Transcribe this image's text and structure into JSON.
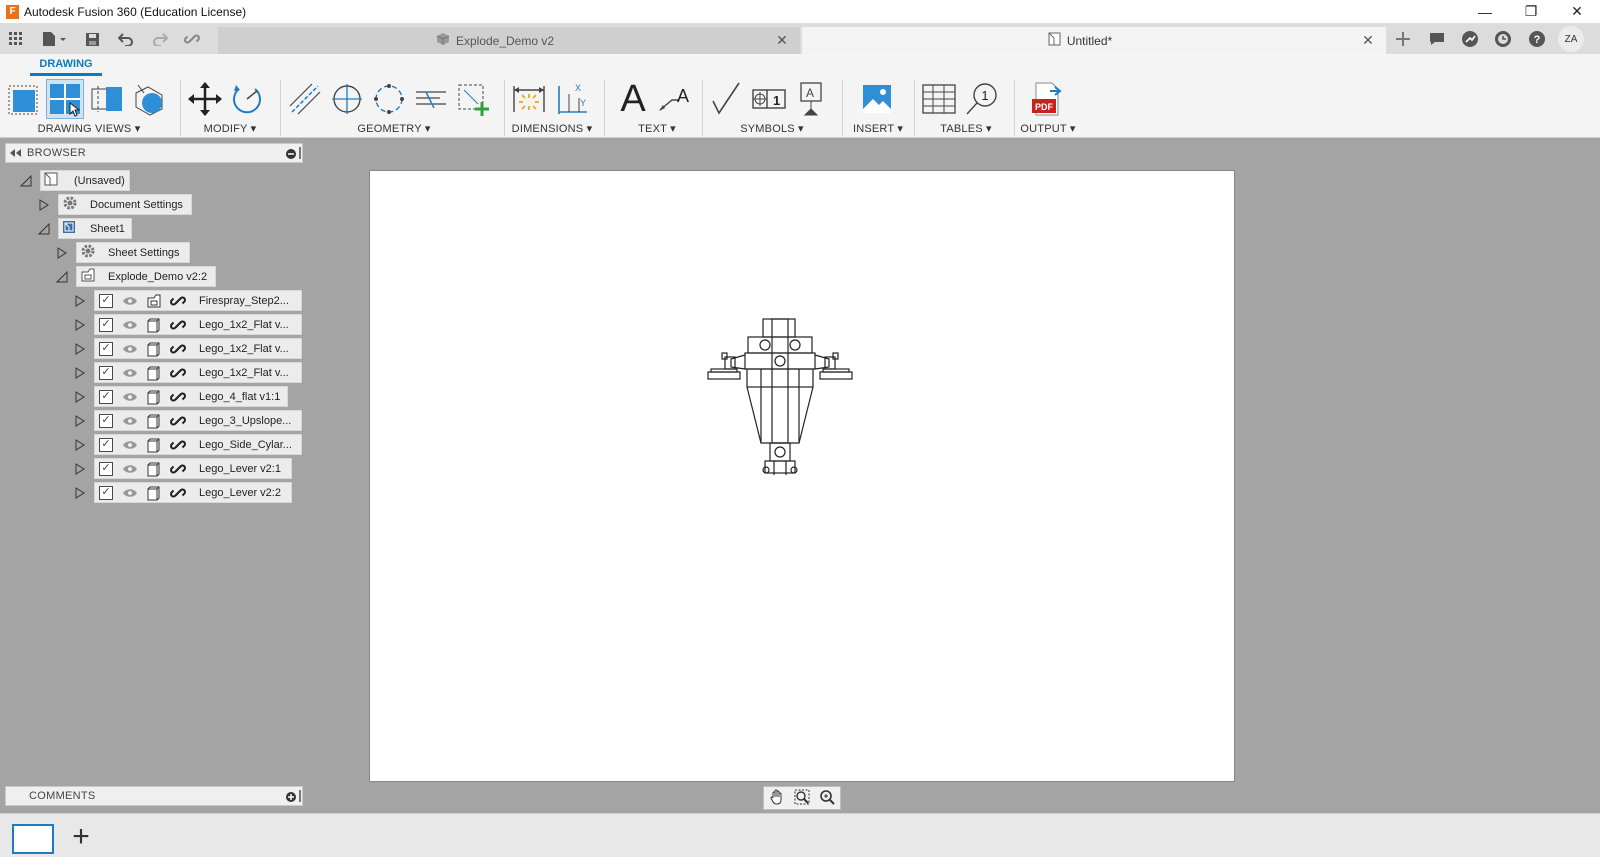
{
  "window": {
    "title": "Autodesk Fusion 360 (Education License)",
    "logo_letter": "F",
    "minimize_glyph": "—",
    "maximize_glyph": "❐",
    "close_glyph": "✕"
  },
  "tabs": [
    {
      "label": "Explode_Demo v2",
      "active": false
    },
    {
      "label": "Untitled*",
      "active": true
    }
  ],
  "tab_close_glyph": "✕",
  "user": {
    "initials": "ZA"
  },
  "workspace_tab": "DRAWING",
  "toolbar_groups": [
    {
      "label": "DRAWING VIEWS ▾"
    },
    {
      "label": "MODIFY ▾"
    },
    {
      "label": "GEOMETRY ▾"
    },
    {
      "label": "DIMENSIONS ▾"
    },
    {
      "label": "TEXT ▾"
    },
    {
      "label": "SYMBOLS ▾"
    },
    {
      "label": "INSERT ▾"
    },
    {
      "label": "TABLES ▾"
    },
    {
      "label": "OUTPUT ▾"
    }
  ],
  "text_tool_glyph": "A",
  "symbols_tool_glyph": "√",
  "pdf_label": "PDF",
  "balloon_label": "1",
  "browser": {
    "header": "BROWSER",
    "root": "(Unsaved)",
    "document_settings": "Document Settings",
    "sheet": "Sheet1",
    "sheet_settings": "Sheet Settings",
    "view": "Explode_Demo v2:2",
    "components": [
      "Firespray_Step2...",
      "Lego_1x2_Flat v...",
      "Lego_1x2_Flat v...",
      "Lego_1x2_Flat v...",
      "Lego_4_flat v1:1",
      "Lego_3_Upslope...",
      "Lego_Side_Cylar...",
      "Lego_Lever v2:1",
      "Lego_Lever v2:2"
    ],
    "check_glyph": "✓"
  },
  "comments": {
    "header": "COMMENTS"
  },
  "add_sheet_glyph": "+"
}
